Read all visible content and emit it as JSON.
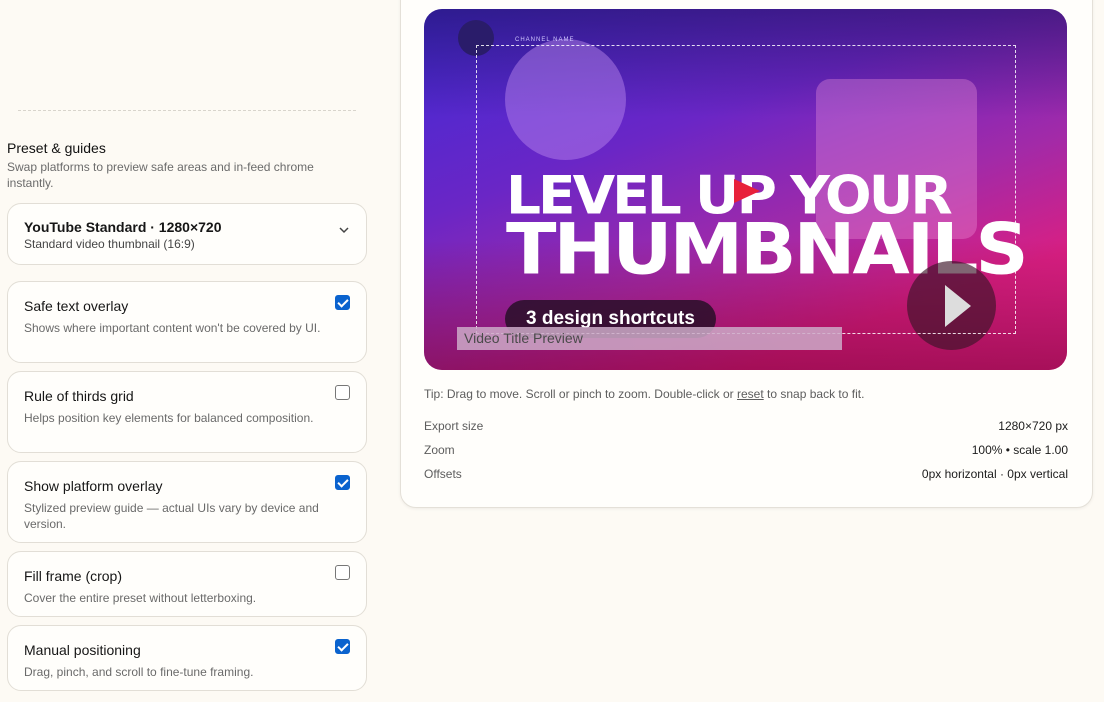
{
  "guides": {
    "title": "Preset & guides",
    "description": "Swap platforms to preview safe areas and in-feed chrome instantly."
  },
  "preset": {
    "selected_label": "YouTube Standard · 1280×720",
    "selected_sub": "Standard video thumbnail (16:9)",
    "icon": "chevron-down-icon"
  },
  "options": [
    {
      "title": "Safe text overlay",
      "description": "Shows where important content won't be covered by UI.",
      "checked": true
    },
    {
      "title": "Rule of thirds grid",
      "description": "Helps position key elements for balanced composition.",
      "checked": false
    },
    {
      "title": "Show platform overlay",
      "description": "Stylized preview guide — actual UIs vary by device and version.",
      "checked": true
    },
    {
      "title": "Fill frame (crop)",
      "description": "Cover the entire preset without letterboxing.",
      "checked": false
    },
    {
      "title": "Manual positioning",
      "description": "Drag, pinch, and scroll to fine-tune framing.",
      "checked": true
    }
  ],
  "preview": {
    "tiny_label": "CHANNEL NAME",
    "headline_line1": "LEVEL UP YOUR",
    "headline_line2": "THUMBNAILS",
    "pill_text": "3 design shortcuts",
    "title_overlay": "Video Title Preview",
    "colors": {
      "gradient_start": "#3f2ad6",
      "gradient_end": "#e0248a"
    }
  },
  "tip": {
    "before": "Tip: Drag to move. Scroll or pinch to zoom. Double-click or ",
    "link": "reset",
    "after": " to snap back to fit."
  },
  "stats": [
    {
      "label": "Export size",
      "value": "1280×720 px"
    },
    {
      "label": "Zoom",
      "value": "100% • scale 1.00"
    },
    {
      "label": "Offsets",
      "value": "0px horizontal · 0px vertical"
    }
  ]
}
